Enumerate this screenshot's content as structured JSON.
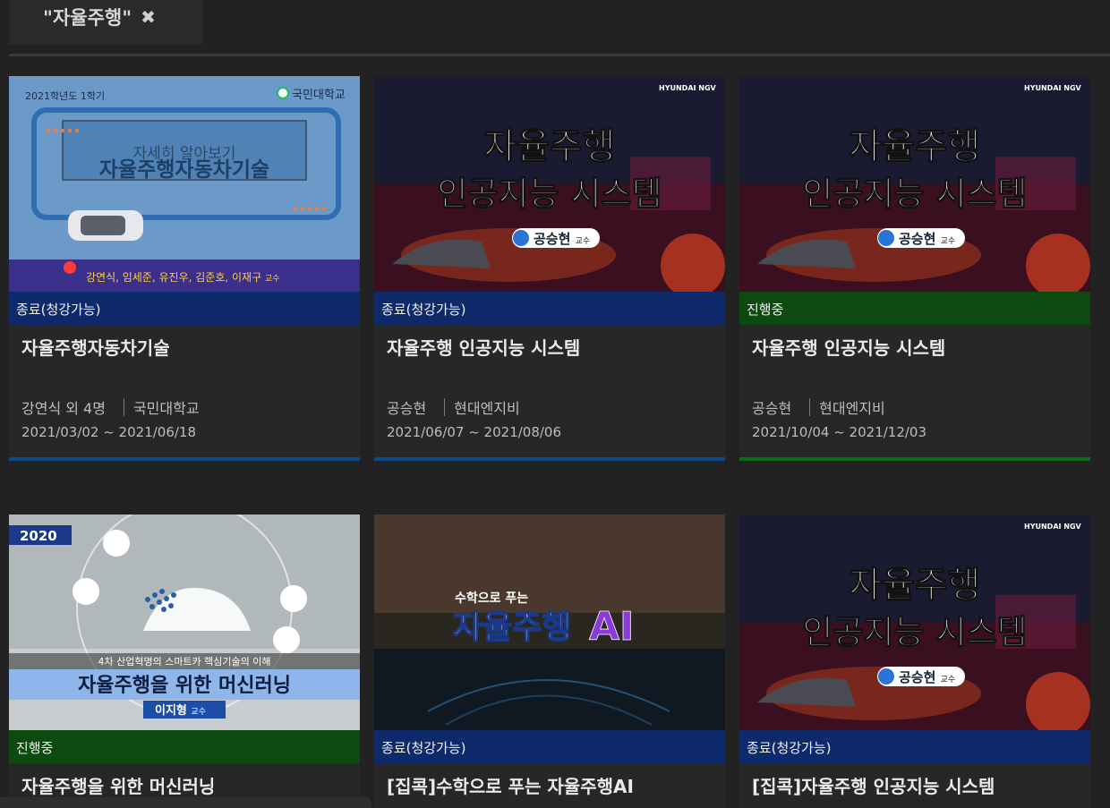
{
  "filter": {
    "label": "\"자율주행\"",
    "close_glyph": "✖"
  },
  "cards": [
    {
      "status": "종료(청강가능)",
      "status_color": "#0f2a6a",
      "line_color": "#0b4a8a",
      "title": "자율주행자동차기술",
      "instructor": "강연식 외 4명",
      "org": "국민대학교",
      "dates": "2021/03/02 ~ 2021/06/18",
      "thumb": {
        "semester": "2021학년도 1학기",
        "school": "국민대학교",
        "overlay_small": "자세히 알아보기",
        "overlay_big": "자율주행자동차기술",
        "names": "강연식, 임세준, 유진우, 김준호, 이재구",
        "names_suffix": "교수"
      }
    },
    {
      "status": "종료(청강가능)",
      "status_color": "#0f2a6a",
      "line_color": "#0b4a8a",
      "title": "자율주행 인공지능 시스템",
      "instructor": "공승현",
      "org": "현대엔지비",
      "dates": "2021/06/07 ~ 2021/08/06",
      "thumb": {
        "brand": "HYUNDAI NGV",
        "line1": "자율주행",
        "line2": "인공지능 시스템",
        "prof": "공승현",
        "prof_suffix": "교수"
      }
    },
    {
      "status": "진행중",
      "status_color": "#0c4a10",
      "line_color": "#0c6a12",
      "title": "자율주행 인공지능 시스템",
      "instructor": "공승현",
      "org": "현대엔지비",
      "dates": "2021/10/04 ~ 2021/12/03",
      "thumb": {
        "brand": "HYUNDAI NGV",
        "line1": "자율주행",
        "line2": "인공지능 시스템",
        "prof": "공승현",
        "prof_suffix": "교수"
      }
    },
    {
      "status": "진행중",
      "status_color": "#0c4a10",
      "title": "자율주행을 위한 머신러닝",
      "thumb": {
        "year": "2020",
        "subtitle": "4차 산업혁명의 스마트카 핵심기술의 이해",
        "main": "자율주행을 위한 머신러닝",
        "prof": "이지형",
        "prof_suffix": "교수"
      }
    },
    {
      "status": "종료(청강가능)",
      "status_color": "#0f2a6a",
      "title": "[집콕]수학으로 푸는 자율주행AI",
      "thumb": {
        "small": "수학으로 푸는",
        "big": "자율주행",
        "ai": "AI"
      }
    },
    {
      "status": "종료(청강가능)",
      "status_color": "#0f2a6a",
      "title": "[집콕]자율주행 인공지능 시스템",
      "thumb": {
        "brand": "HYUNDAI NGV",
        "line1": "자율주행",
        "line2": "인공지능 시스템",
        "prof": "공승현",
        "prof_suffix": "교수"
      }
    }
  ]
}
